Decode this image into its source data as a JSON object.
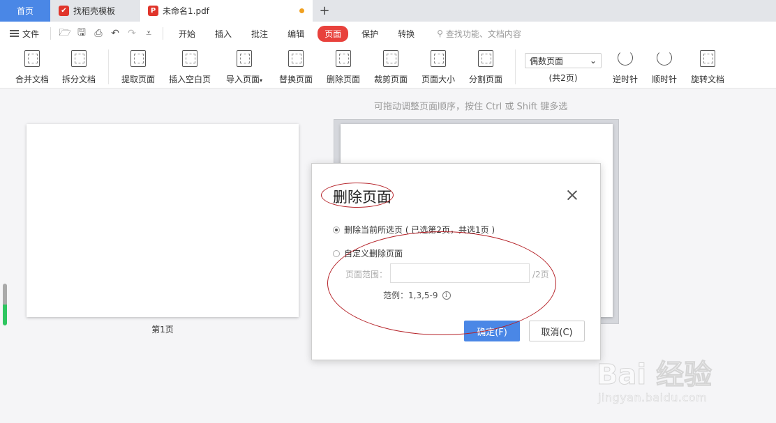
{
  "tabs": {
    "home": "首页",
    "template": "找稻壳模板",
    "doc": "未命名1.pdf",
    "add": "+"
  },
  "menubar": {
    "file": "文件",
    "items": [
      "开始",
      "插入",
      "批注",
      "编辑",
      "页面",
      "保护",
      "转换"
    ],
    "active": "页面",
    "search_placeholder": "查找功能、文档内容"
  },
  "ribbon": {
    "buttons": [
      "合并文档",
      "拆分文档",
      "提取页面",
      "插入空白页",
      "导入页面",
      "替换页面",
      "删除页面",
      "裁剪页面",
      "页面大小",
      "分割页面",
      "逆时针",
      "顺时针",
      "旋转文档"
    ],
    "page_select": "偶数页面",
    "page_count": "(共2页)",
    "import_dropdown": "▾"
  },
  "workspace": {
    "hint": "可拖动调整页面顺序，按住 Ctrl 或 Shift 键多选",
    "page1_label": "第1页"
  },
  "dialog": {
    "title": "删除页面",
    "option_current": "删除当前所选页 ( 已选第2页，共选1页 )",
    "option_custom": "自定义删除页面",
    "range_label": "页面范围：",
    "range_value": "",
    "range_suffix": "/2页",
    "example": "范例：1,3,5-9",
    "ok": "确定(F)",
    "cancel": "取消(C)"
  },
  "watermark": {
    "main": "Bai  经验",
    "sub": "jingyan.baidu.com"
  },
  "colors": {
    "accent": "#4a87e6",
    "active_menu": "#e8413c",
    "annotation": "#b52228"
  }
}
